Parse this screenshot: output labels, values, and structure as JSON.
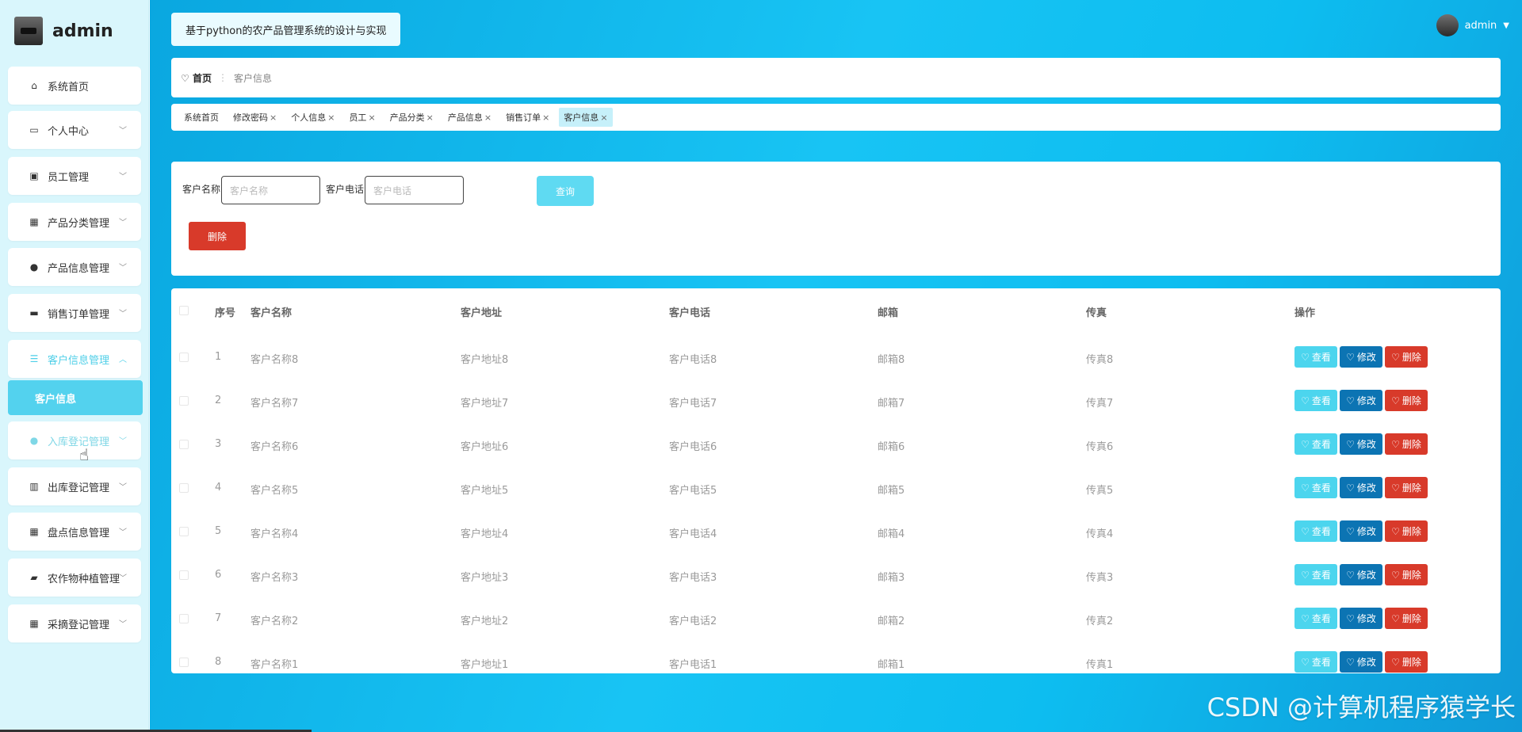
{
  "brand": {
    "name": "admin"
  },
  "site_title": "基于python的农产品管理系统的设计与实现",
  "user": {
    "name": "admin"
  },
  "sidebar": {
    "items": [
      {
        "label": "系统首页",
        "icon": "home-icon",
        "symbol": "⌂"
      },
      {
        "label": "个人中心",
        "icon": "calendar-icon",
        "symbol": "▭"
      },
      {
        "label": "员工管理",
        "icon": "clipboard-icon",
        "symbol": "▣"
      },
      {
        "label": "产品分类管理",
        "icon": "grid-icon",
        "symbol": "▦"
      },
      {
        "label": "产品信息管理",
        "icon": "user-icon",
        "symbol": "●"
      },
      {
        "label": "销售订单管理",
        "icon": "briefcase-icon",
        "symbol": "▬"
      },
      {
        "label": "客户信息管理",
        "icon": "list-icon",
        "symbol": "☰"
      },
      {
        "label": "入库登记管理",
        "icon": "person-icon",
        "symbol": "●"
      },
      {
        "label": "出库登记管理",
        "icon": "book-icon",
        "symbol": "▥"
      },
      {
        "label": "盘点信息管理",
        "icon": "grid-icon",
        "symbol": "▦"
      },
      {
        "label": "农作物种植管理",
        "icon": "wallet-icon",
        "symbol": "▰"
      },
      {
        "label": "采摘登记管理",
        "icon": "grid-icon",
        "symbol": "▦"
      }
    ],
    "sub_item": "客户信息"
  },
  "breadcrumb": {
    "home": "首页",
    "current": "客户信息"
  },
  "tags": [
    {
      "label": "系统首页",
      "closable": false
    },
    {
      "label": "修改密码",
      "closable": true
    },
    {
      "label": "个人信息",
      "closable": true
    },
    {
      "label": "员工",
      "closable": true
    },
    {
      "label": "产品分类",
      "closable": true
    },
    {
      "label": "产品信息",
      "closable": true
    },
    {
      "label": "销售订单",
      "closable": true
    },
    {
      "label": "客户信息",
      "closable": true,
      "active": true
    }
  ],
  "search": {
    "name_label": "客户名称",
    "name_placeholder": "客户名称",
    "phone_label": "客户电话",
    "phone_placeholder": "客户电话",
    "query_button": "查询",
    "delete_button": "删除"
  },
  "table": {
    "headers": [
      "序号",
      "客户名称",
      "客户地址",
      "客户电话",
      "邮箱",
      "传真",
      "操作"
    ],
    "rows": [
      [
        "1",
        "客户名称8",
        "客户地址8",
        "客户电话8",
        "邮箱8",
        "传真8"
      ],
      [
        "2",
        "客户名称7",
        "客户地址7",
        "客户电话7",
        "邮箱7",
        "传真7"
      ],
      [
        "3",
        "客户名称6",
        "客户地址6",
        "客户电话6",
        "邮箱6",
        "传真6"
      ],
      [
        "4",
        "客户名称5",
        "客户地址5",
        "客户电话5",
        "邮箱5",
        "传真5"
      ],
      [
        "5",
        "客户名称4",
        "客户地址4",
        "客户电话4",
        "邮箱4",
        "传真4"
      ],
      [
        "6",
        "客户名称3",
        "客户地址3",
        "客户电话3",
        "邮箱3",
        "传真3"
      ],
      [
        "7",
        "客户名称2",
        "客户地址2",
        "客户电话2",
        "邮箱2",
        "传真2"
      ],
      [
        "8",
        "客户名称1",
        "客户地址1",
        "客户电话1",
        "邮箱1",
        "传真1"
      ]
    ],
    "actions": {
      "view": "查看",
      "edit": "修改",
      "delete": "删除"
    }
  },
  "watermark": "CSDN @计算机程序猿学长",
  "colors": {
    "accent": "#4fcfe8",
    "danger": "#d83a2a",
    "edit": "#0c74b3",
    "background": "#0aa7e0"
  }
}
